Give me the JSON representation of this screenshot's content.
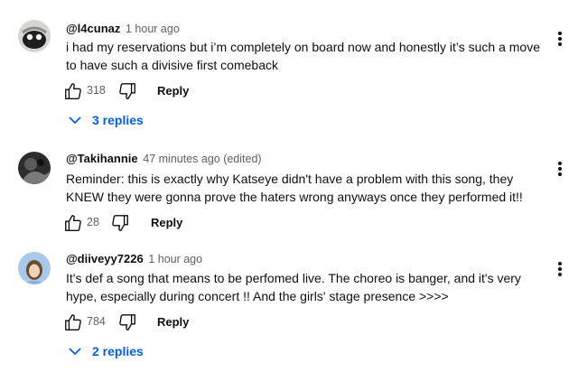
{
  "comments": [
    {
      "author": "@l4cunaz",
      "time": "1 hour ago",
      "text": "i had my reservations but i’m completely on board now and honestly it’s such a move to have such a divisive first comeback",
      "likes": "318",
      "reply_label": "Reply",
      "replies_label": "3 replies",
      "avatar_color": "#c9c6c2"
    },
    {
      "author": "@Takihannie",
      "time": "47 minutes ago (edited)",
      "text": "Reminder: this is exactly why Katseye didn't have a problem with this song, they KNEW they were gonna prove the haters wrong anyways once they performed it!!",
      "likes": "28",
      "reply_label": "Reply",
      "avatar_color": "#2b2b2b"
    },
    {
      "author": "@diiveyy7226",
      "time": "1 hour ago",
      "text": "It's def a song that means to be perfomed live. The choreo is banger, and it's very hype, especially during concert !! And the girls' stage presence >>>>",
      "likes": "784",
      "reply_label": "Reply",
      "replies_label": "2 replies",
      "avatar_color": "#a9c9ea"
    }
  ],
  "colors": {
    "link_blue": "#065fd4",
    "meta_gray": "#606060"
  },
  "icons": [
    "thumbs-up-icon",
    "thumbs-down-icon",
    "more-vert-icon",
    "chevron-down-icon"
  ]
}
